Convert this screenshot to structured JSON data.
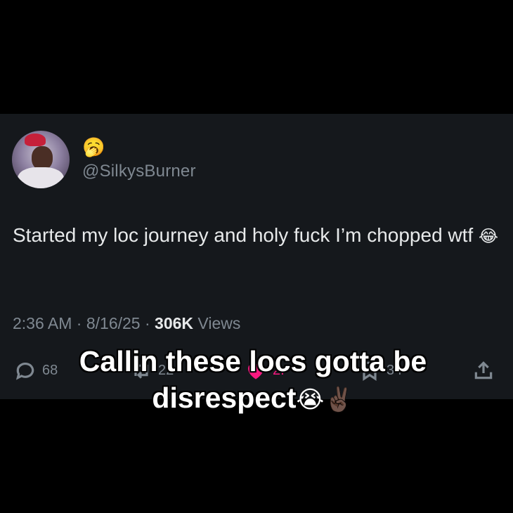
{
  "tweet": {
    "display_name_emoji": "🥱",
    "handle": "@SilkysBurner",
    "text": "Started my loc journey and holy fuck I’m chopped wtf",
    "text_emoji": "😂",
    "time": "2:36 AM",
    "date": "8/16/25",
    "views_count": "306K",
    "views_label": "Views",
    "separator": "·"
  },
  "actions": {
    "reply_count": "68",
    "retweet_count": "22",
    "like_count": "2.",
    "bookmark_count": "34"
  },
  "caption": {
    "line1": "Callin these locs gotta be",
    "line2": "disrespect",
    "emojis": "😭✌🏿"
  },
  "colors": {
    "background": "#000000",
    "card": "#15181c",
    "text_primary": "#e7e9ea",
    "text_secondary": "#7f8891",
    "like_pink": "#f91880"
  }
}
